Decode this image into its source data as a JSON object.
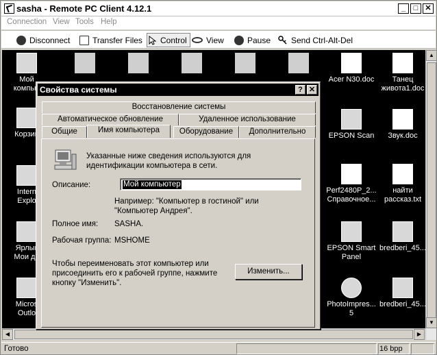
{
  "window": {
    "title": "sasha - Remote PC Client 4.12.1",
    "controls": {
      "minimize": "_",
      "maximize": "□",
      "close": "✕"
    }
  },
  "menu": [
    "Connection",
    "View",
    "Tools",
    "Help"
  ],
  "toolbar": {
    "disconnect": "Disconnect",
    "transfer_files": "Transfer Files",
    "control": "Control",
    "view": "View",
    "pause": "Pause",
    "send_cad": "Send Ctrl-Alt-Del"
  },
  "desktop": {
    "icons": [
      {
        "label": "Мой\nкомпью",
        "icon": "my-computer-icon"
      },
      {
        "label": "Корзин",
        "icon": "recycle-bin-icon"
      },
      {
        "label": "Intern\nExplo",
        "icon": "internet-explorer-icon"
      },
      {
        "label": "Ярлык\nМои до",
        "icon": "folder-shortcut-icon"
      },
      {
        "label": "Micros\nOutlo",
        "icon": "outlook-icon"
      },
      {
        "label": "Acer N30.doc",
        "icon": "word-doc-icon"
      },
      {
        "label": "Танец\nживота1.doc",
        "icon": "word-doc-icon"
      },
      {
        "label": "EPSON Scan",
        "icon": "scanner-icon"
      },
      {
        "label": "Звук.doc",
        "icon": "word-doc-icon"
      },
      {
        "label": "Perf2480P_2...\nСправочное...",
        "icon": "epson-doc-icon"
      },
      {
        "label": "найти\nрассказ.txt",
        "icon": "text-file-icon"
      },
      {
        "label": "EPSON Smart\nPanel",
        "icon": "epson-smart-panel-icon"
      },
      {
        "label": "bredberi_45...",
        "icon": "archive-icon"
      },
      {
        "label": "PhotoImpres...\n5",
        "icon": "photoimpression-icon"
      },
      {
        "label": "bredberi_45...",
        "icon": "folder-icon"
      }
    ]
  },
  "dialog": {
    "title": "Свойства системы",
    "help_btn": "?",
    "close_btn": "✕",
    "tabs_row1": [
      "Восстановление системы"
    ],
    "tabs_row2": [
      "Автоматическое обновление",
      "Удаленное использование"
    ],
    "tabs_row3": [
      "Общие",
      "Имя компьютера",
      "Оборудование",
      "Дополнительно"
    ],
    "active_tab": "Имя компьютера",
    "intro": "Указанные ниже сведения используются для\nидентификации компьютера в сети.",
    "description_label": "Описание:",
    "description_value": "Мой компьютер",
    "example": "Например: \"Компьютер в гостиной\" или\n\"Компьютер Андрея\".",
    "fullname_label": "Полное имя:",
    "fullname_value": "SASHA.",
    "workgroup_label": "Рабочая группа:",
    "workgroup_value": "MSHOME",
    "rename_text": "Чтобы переименовать этот компьютер или\nприсоединить его к рабочей группе, нажмите\nкнопку \"Изменить\".",
    "change_button": "Изменить..."
  },
  "status": {
    "ready": "Готово",
    "bpp": "16 bpp"
  }
}
